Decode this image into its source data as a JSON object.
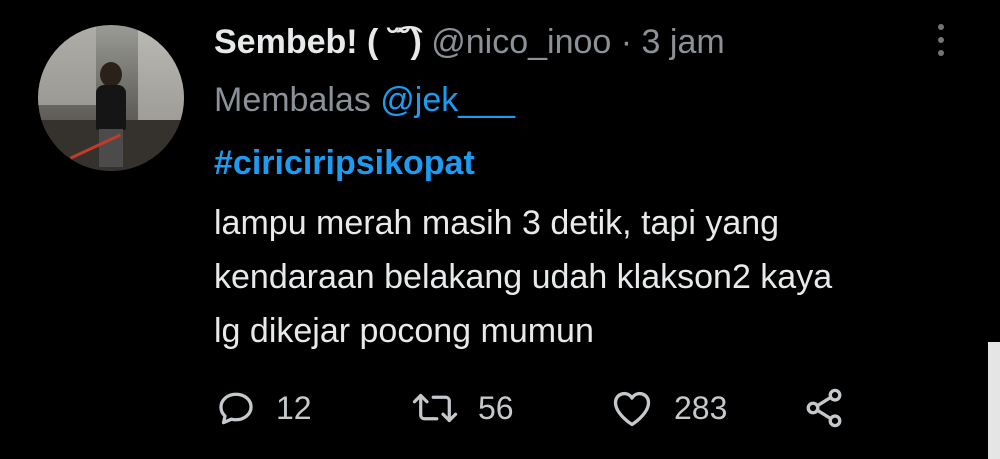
{
  "tweet": {
    "display_name": "Sembeb! ( ˘͡˘)",
    "handle": "@nico_inoo",
    "separator": "·",
    "time": "3 jam",
    "reply_prefix": "Membalas",
    "reply_to": "@jek___",
    "hashtag": "#ciriciripsikopat",
    "body_lines": [
      "lampu merah masih 3 detik, tapi yang",
      "kendaraan belakang udah klakson2 kaya",
      "lg dikejar pocong mumun"
    ]
  },
  "actions": {
    "reply": {
      "icon": "reply-icon",
      "count": "12"
    },
    "retweet": {
      "icon": "retweet-icon",
      "count": "56"
    },
    "like": {
      "icon": "heart-icon",
      "count": "283"
    },
    "share": {
      "icon": "share-icon"
    }
  },
  "colors": {
    "background": "#000000",
    "text": "#e7e9ea",
    "secondary": "#8b9197",
    "link": "#1d9bf0"
  }
}
